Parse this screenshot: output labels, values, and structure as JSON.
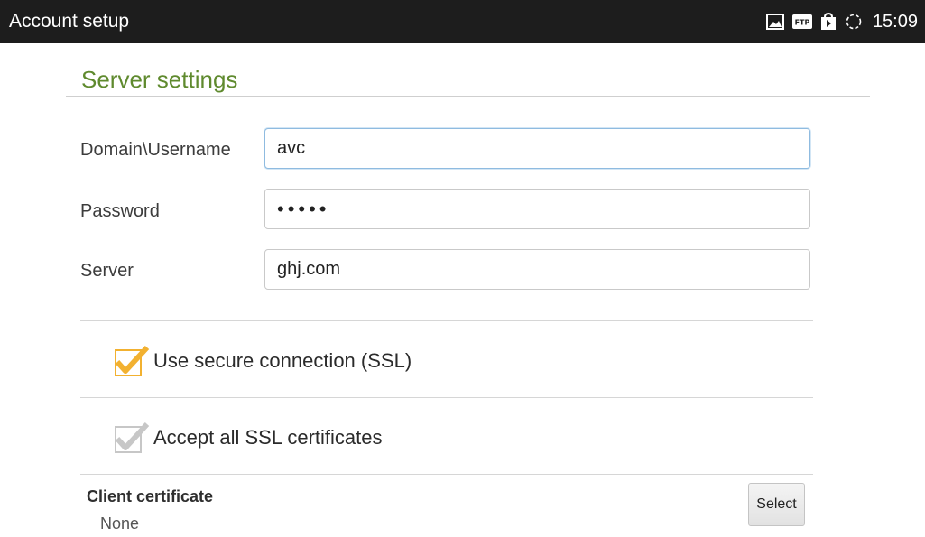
{
  "status_bar": {
    "title": "Account setup",
    "time": "15:09",
    "icons": [
      "image-icon",
      "ftp-icon",
      "store-icon",
      "sync-icon"
    ],
    "ftp_text": "FTP"
  },
  "section": {
    "title": "Server settings"
  },
  "form": {
    "username_label": "Domain\\Username",
    "username_value": "avc",
    "password_label": "Password",
    "password_value": "•••••",
    "server_label": "Server",
    "server_value": "ghj.com"
  },
  "options": {
    "ssl_label": "Use secure connection (SSL)",
    "ssl_checked": true,
    "accept_all_label": "Accept all SSL certificates",
    "accept_all_checked": true,
    "accept_all_enabled": false
  },
  "client_certificate": {
    "title": "Client certificate",
    "value": "None",
    "select_label": "Select"
  },
  "colors": {
    "accent_green": "#5f8a2e",
    "checkbox_orange": "#f2b130",
    "checkbox_disabled": "#c7c7c7",
    "topbar": "#1d1d1d"
  }
}
